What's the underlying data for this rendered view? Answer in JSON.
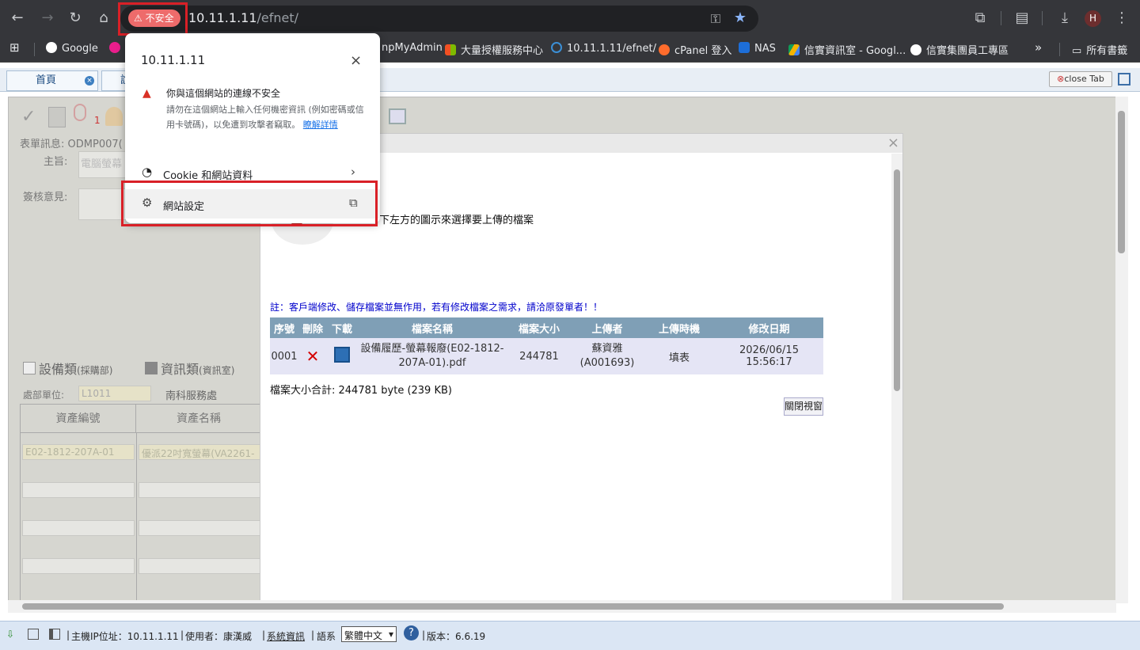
{
  "browser": {
    "security_chip": "不安全",
    "url_host": "10.11.1.11",
    "url_path": "/efnet/",
    "profile_initial": "H"
  },
  "bookmarks": {
    "items": [
      "Google",
      "npMyAdmin",
      "大量授權服務中心",
      "10.11.1.11/efnet/",
      "cPanel 登入",
      "NAS",
      "信實資訊室 - Googl...",
      "信實集團員工專區"
    ],
    "all_bookmarks": "所有書籤",
    "overflow": "»"
  },
  "site_popup": {
    "host": "10.11.1.11",
    "warning_title": "你與這個網站的連線不安全",
    "warning_body": "請勿在這個網站上輸入任何機密資訊 (例如密碼或信用卡號碼)，以免遭到攻擊者竊取。",
    "learn_more": "瞭解詳情",
    "cookies": "Cookie 和網站資料",
    "site_settings": "網站設定"
  },
  "tabs": {
    "home": "首頁",
    "second_partial": "說",
    "close_tab": "close Tab"
  },
  "form": {
    "badge_count": "1",
    "form_info_label": "表單訊息:",
    "form_info_value": "ODMP007(",
    "subject_label": "主旨:",
    "subject_value": "電腦螢幕",
    "opinion_label": "簽核意見:",
    "equipment_type": "設備類",
    "equipment_sub": "(採購部)",
    "info_type": "資訊類",
    "info_sub": "(資訊室)",
    "dept_label": "處部單位:",
    "dept_code": "L1011",
    "dept_name": "南科服務處",
    "col_asset_no": "資產編號",
    "col_asset_name": "資產名稱",
    "asset_no": "E02-1812-207A-01",
    "asset_name": "優派22吋寬螢幕(VA2261-"
  },
  "upload_modal": {
    "instruction": "下左方的圖示來選擇要上傳的檔案",
    "note": "註：客戶端修改、儲存檔案並無作用，若有修改檔案之需求，請洽原發單者！！",
    "headers": [
      "序號",
      "刪除",
      "下載",
      "檔案名稱",
      "檔案大小",
      "上傳者",
      "上傳時機",
      "修改日期"
    ],
    "row": {
      "seq": "0001",
      "filename": "設備履歷-螢幕報廢(E02-1812-207A-01).pdf",
      "size": "244781",
      "uploader": "蘇資雅",
      "uploader_id": "(A001693)",
      "timing": "填表",
      "modified": "2026/06/15 15:56:17"
    },
    "total": "檔案大小合計: 244781 byte (239 KB)",
    "close_button": "關閉視窗"
  },
  "statusbar": {
    "host_ip": "主機IP位址：10.11.1.11",
    "user": "使用者：康漢威",
    "sys_info": "系統資訊",
    "language_label": "語系",
    "language_value": "繁體中文",
    "version": "版本：6.6.19"
  },
  "colors": {
    "chrome_dark": "#35363a",
    "insecure_red": "#ee6b6b",
    "highlight_red": "#d92027",
    "table_header": "#7f9fb6",
    "table_row": "#e5e5f5",
    "note_blue": "#0000cc"
  }
}
